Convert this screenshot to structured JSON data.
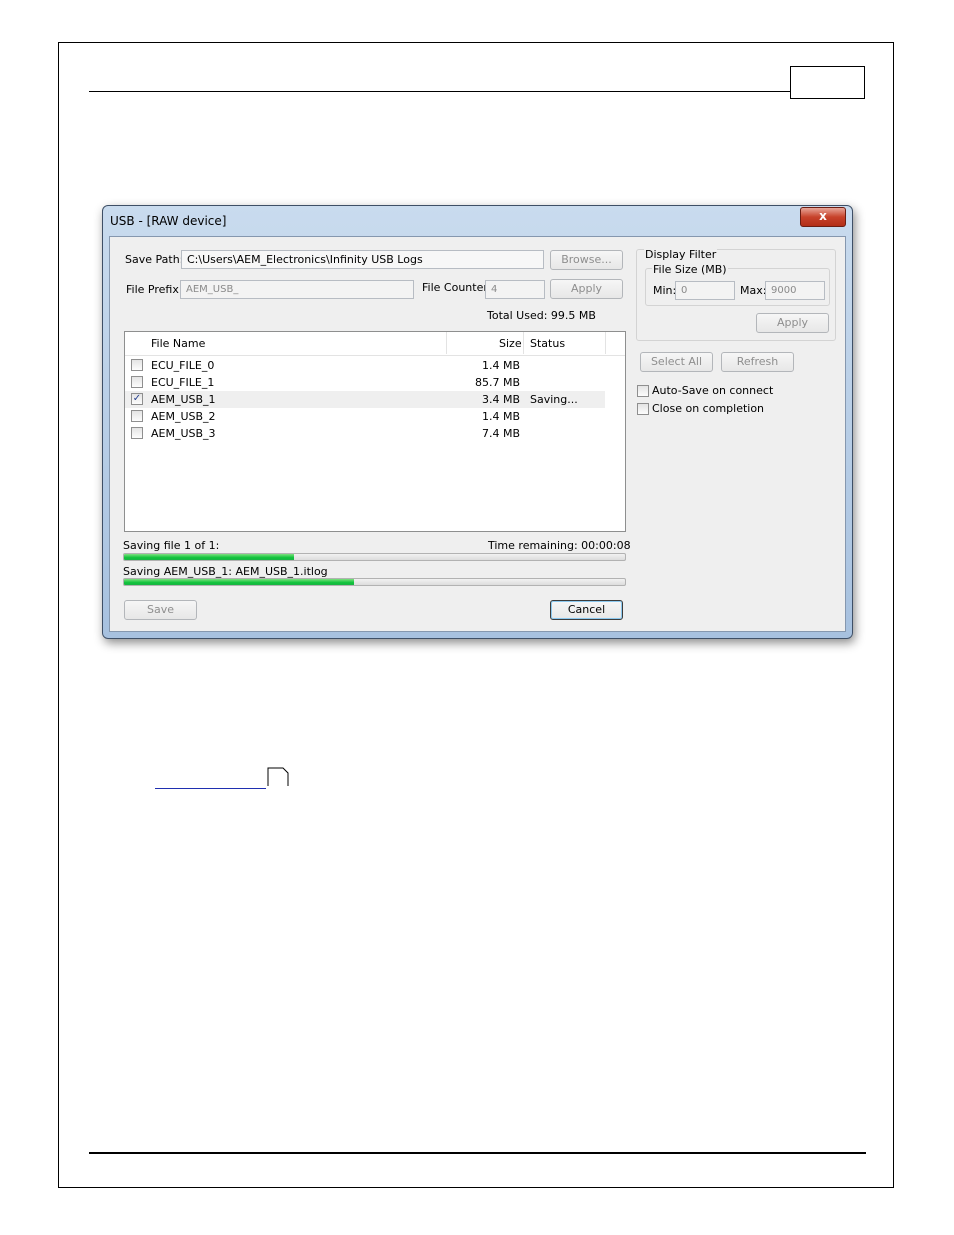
{
  "window": {
    "title": "USB - [RAW device]",
    "close_glyph": "x"
  },
  "save_path": {
    "label": "Save Path:",
    "value": "C:\\Users\\AEM_Electronics\\Infinity USB Logs",
    "browse_label": "Browse..."
  },
  "file_prefix": {
    "label": "File Prefix:",
    "value": "AEM_USB_"
  },
  "file_counter": {
    "label": "File Counter:",
    "value": "4",
    "apply_label": "Apply"
  },
  "total_used": "Total Used: 99.5 MB",
  "file_list": {
    "columns": {
      "name": "File Name",
      "size": "Size",
      "status": "Status"
    },
    "rows": [
      {
        "name": "ECU_FILE_0",
        "size": "1.4 MB",
        "status": "",
        "checked": false,
        "check_glyph": ""
      },
      {
        "name": "ECU_FILE_1",
        "size": "85.7 MB",
        "status": "",
        "checked": false,
        "check_glyph": ""
      },
      {
        "name": "AEM_USB_1",
        "size": "3.4 MB",
        "status": "Saving...",
        "checked": true,
        "check_glyph": "✓"
      },
      {
        "name": "AEM_USB_2",
        "size": "1.4 MB",
        "status": "",
        "checked": false,
        "check_glyph": ""
      },
      {
        "name": "AEM_USB_3",
        "size": "7.4 MB",
        "status": "",
        "checked": false,
        "check_glyph": ""
      }
    ]
  },
  "progress": {
    "overall_label": "Saving file 1 of 1:",
    "time_remaining": "Time remaining: 00:00:08",
    "overall_fraction": 0.34,
    "file_label": "Saving AEM_USB_1: AEM_USB_1.itlog",
    "file_fraction": 0.46
  },
  "buttons": {
    "save": "Save",
    "cancel": "Cancel"
  },
  "display_filter": {
    "title": "Display Filter",
    "file_size_label": "File Size (MB)",
    "min_label": "Min:",
    "min_value": "0",
    "max_label": "Max:",
    "max_value": "9000",
    "apply_label": "Apply"
  },
  "select_all_label": "Select All",
  "refresh_label": "Refresh",
  "options": {
    "auto_save": {
      "label": "Auto-Save on connect",
      "checked": false
    },
    "close_on_completion": {
      "label": "Close on completion",
      "checked": false
    }
  },
  "colors": {
    "progress_fill": "#0fc33b",
    "link": "#1f2fb0",
    "close_button": "#c7422b"
  }
}
